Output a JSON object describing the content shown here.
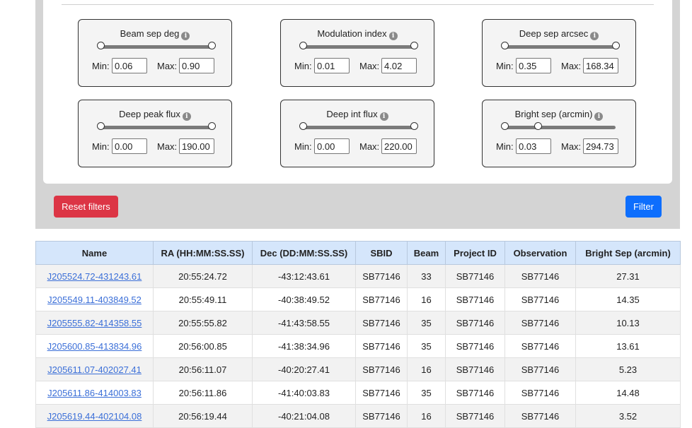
{
  "filters": [
    {
      "label": "Beam sep deg",
      "info_icon": "info-circle-icon",
      "min_label": "Min:",
      "max_label": "Max:",
      "min": "0.06",
      "max": "0.90",
      "handle_low": 0.0,
      "handle_high": 1.0
    },
    {
      "label": "Modulation index",
      "info_icon": "info-circle-icon",
      "min_label": "Min:",
      "max_label": "Max:",
      "min": "0.01",
      "max": "4.02",
      "handle_low": 0.0,
      "handle_high": 1.0
    },
    {
      "label": "Deep sep arcsec",
      "info_icon": "info-circle-icon",
      "min_label": "Min:",
      "max_label": "Max:",
      "min": "0.35",
      "max": "168.34",
      "handle_low": 0.0,
      "handle_high": 1.0
    },
    {
      "label": "Deep peak flux",
      "info_icon": "info-circle-icon",
      "min_label": "Min:",
      "max_label": "Max:",
      "min": "0.00",
      "max": "190.00",
      "handle_low": 0.0,
      "handle_high": 1.0
    },
    {
      "label": "Deep int flux",
      "info_icon": "info-circle-icon",
      "min_label": "Min:",
      "max_label": "Max:",
      "min": "0.00",
      "max": "220.00",
      "handle_low": 0.0,
      "handle_high": 1.0
    },
    {
      "label": "Bright sep (arcmin)",
      "info_icon": "info-circle-icon",
      "min_label": "Min:",
      "max_label": "Max:",
      "min": "0.03",
      "max": "294.73",
      "handle_low": 0.0,
      "handle_high": 0.3
    }
  ],
  "actions": {
    "reset_label": "Reset filters",
    "filter_label": "Filter"
  },
  "colors": {
    "reset": "#dc3545",
    "filter": "#0d6efd",
    "header_bg": "#d5e6fb",
    "link": "#3b6fd8"
  },
  "table": {
    "headers": [
      "Name",
      "RA (HH:MM:SS.SS)",
      "Dec (DD:MM:SS.SS)",
      "SBID",
      "Beam",
      "Project ID",
      "Observation",
      "Bright Sep (arcmin)"
    ],
    "rows": [
      [
        "J205524.72-431243.61",
        "20:55:24.72",
        "-43:12:43.61",
        "SB77146",
        "33",
        "SB77146",
        "SB77146",
        "27.31"
      ],
      [
        "J205549.11-403849.52",
        "20:55:49.11",
        "-40:38:49.52",
        "SB77146",
        "16",
        "SB77146",
        "SB77146",
        "14.35"
      ],
      [
        "J205555.82-414358.55",
        "20:55:55.82",
        "-41:43:58.55",
        "SB77146",
        "35",
        "SB77146",
        "SB77146",
        "10.13"
      ],
      [
        "J205600.85-413834.96",
        "20:56:00.85",
        "-41:38:34.96",
        "SB77146",
        "35",
        "SB77146",
        "SB77146",
        "13.61"
      ],
      [
        "J205611.07-402027.41",
        "20:56:11.07",
        "-40:20:27.41",
        "SB77146",
        "16",
        "SB77146",
        "SB77146",
        "5.23"
      ],
      [
        "J205611.86-414003.83",
        "20:56:11.86",
        "-41:40:03.83",
        "SB77146",
        "35",
        "SB77146",
        "SB77146",
        "14.48"
      ],
      [
        "J205619.44-402104.08",
        "20:56:19.44",
        "-40:21:04.08",
        "SB77146",
        "16",
        "SB77146",
        "SB77146",
        "3.52"
      ]
    ]
  }
}
